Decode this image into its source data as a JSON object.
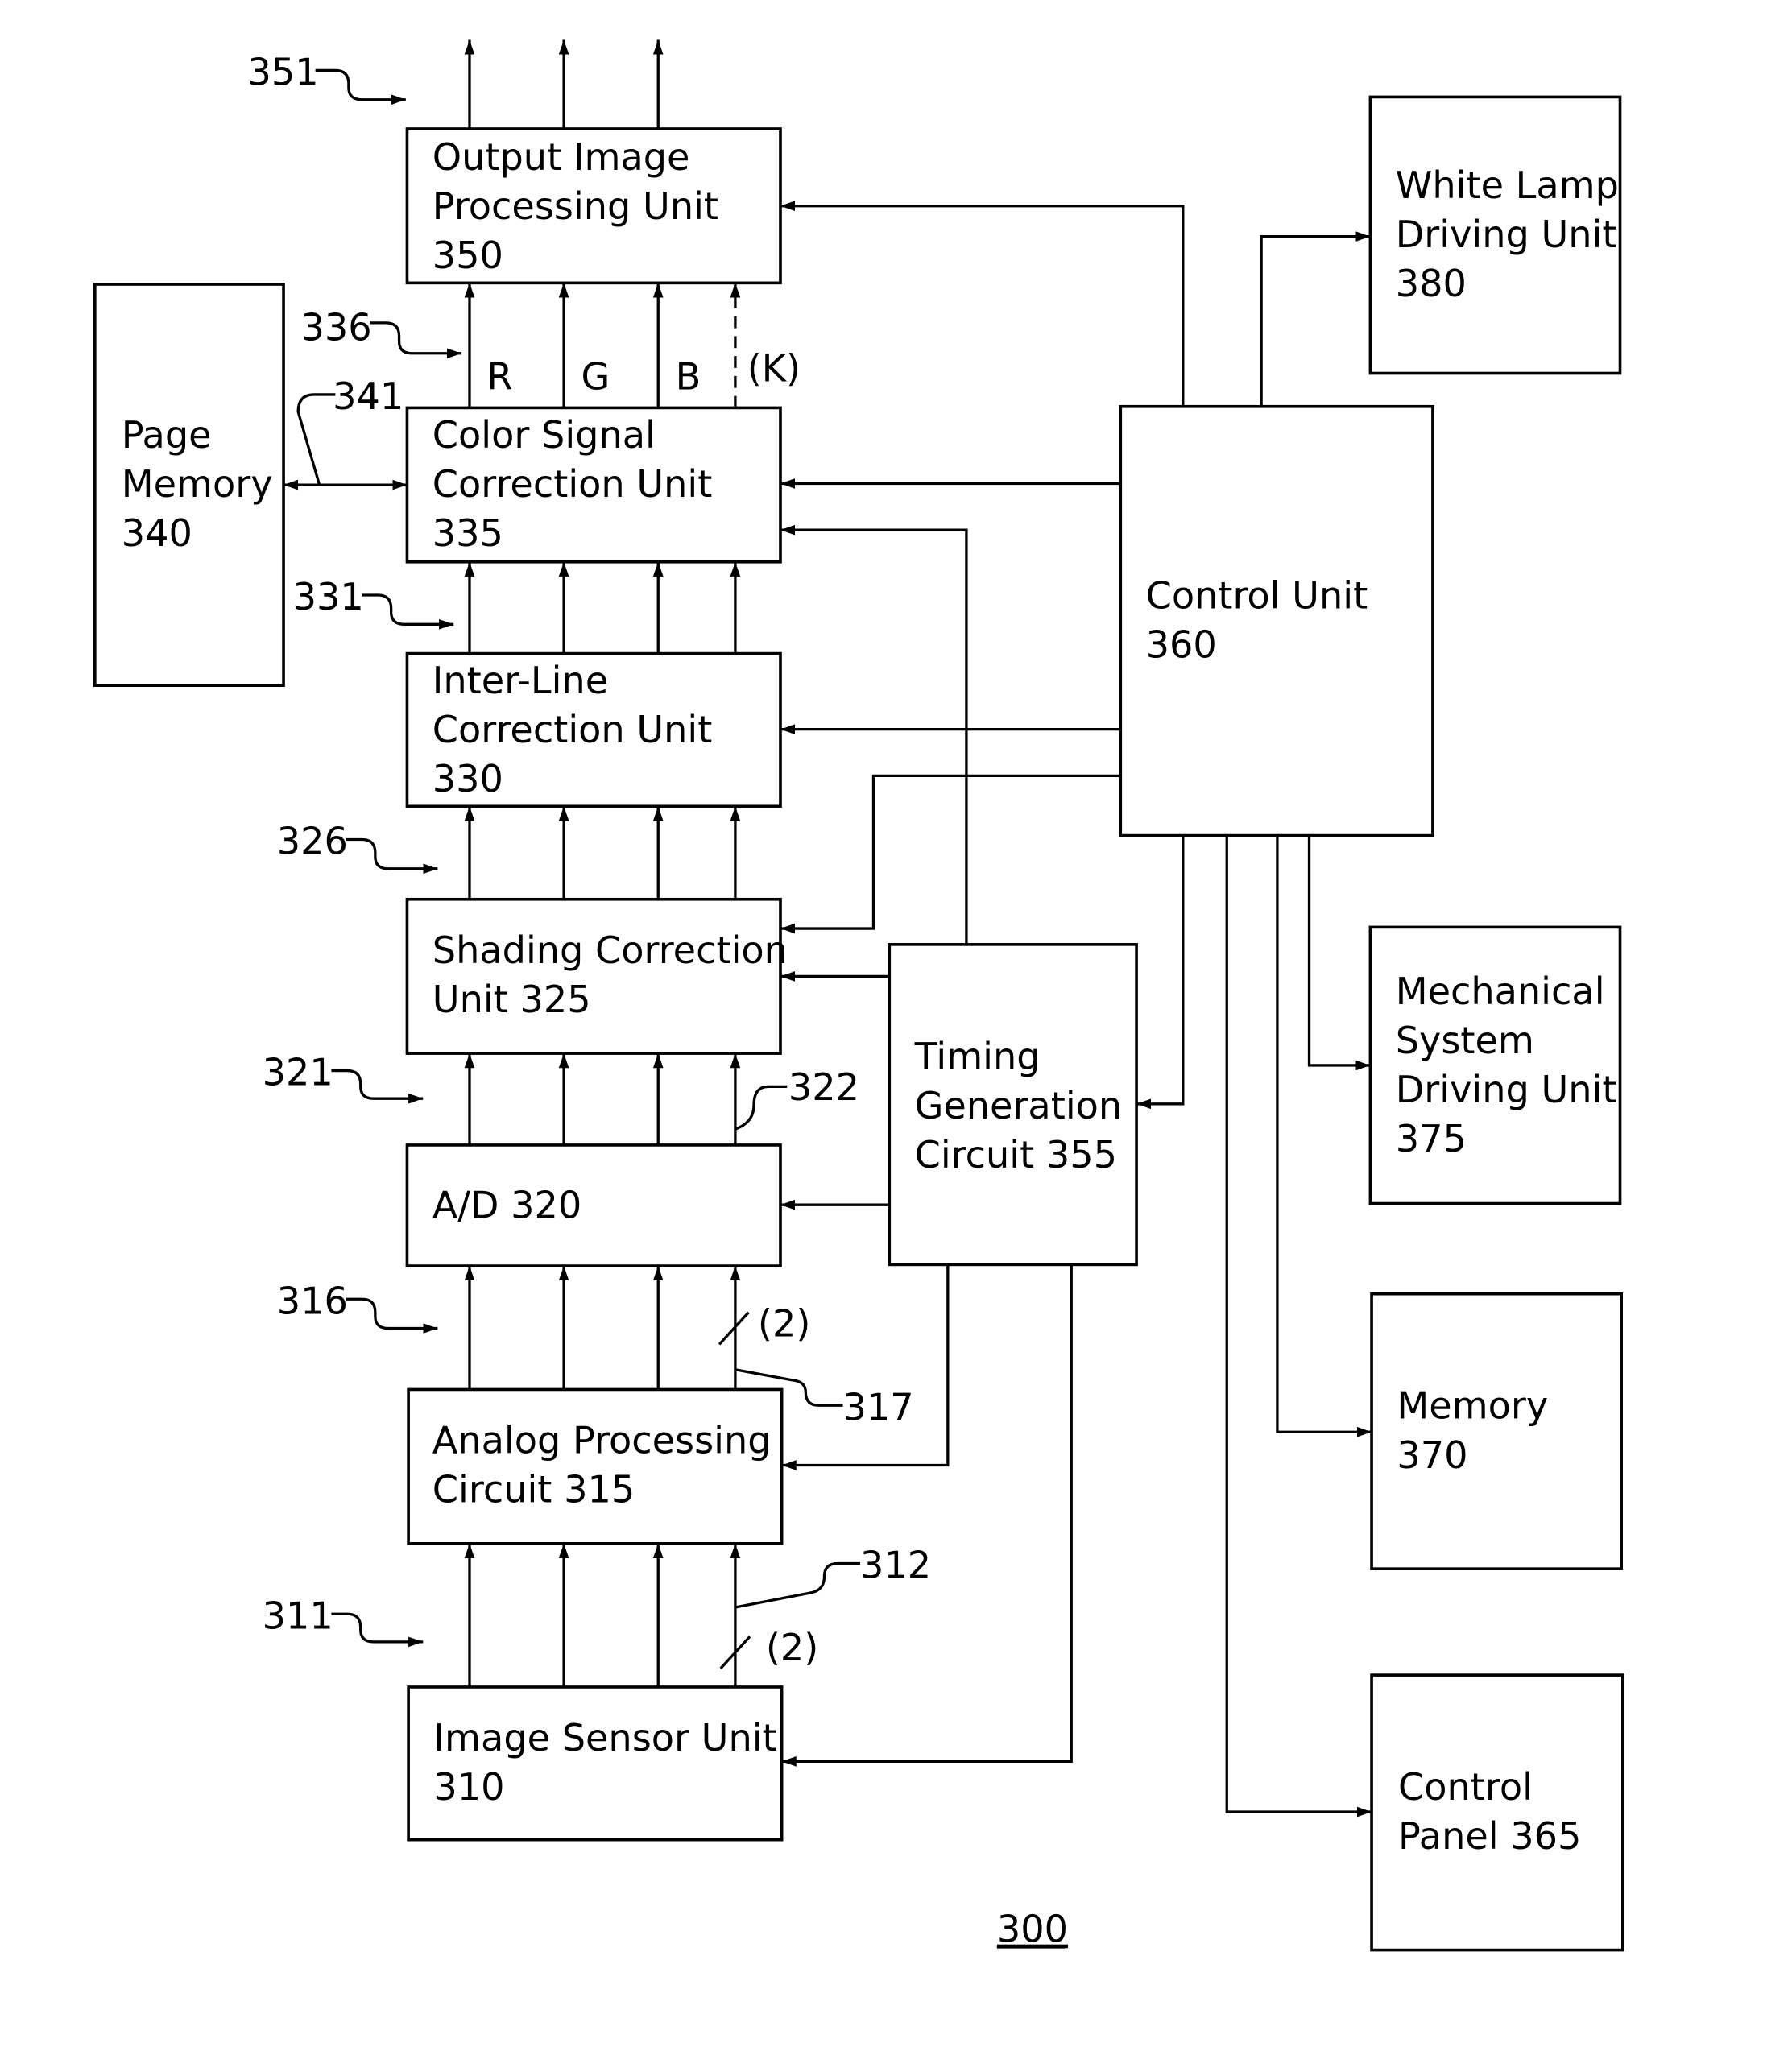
{
  "figure_number": "300",
  "blocks": {
    "output_image_processing": {
      "lines": [
        "Output Image",
        "Processing Unit",
        "350"
      ]
    },
    "color_signal_correction": {
      "lines": [
        "Color Signal",
        "Correction Unit",
        "335"
      ]
    },
    "inter_line_correction": {
      "lines": [
        "Inter-Line",
        "Correction Unit",
        "330"
      ]
    },
    "shading_correction": {
      "lines": [
        "Shading Correction",
        "Unit 325"
      ]
    },
    "ad_converter": {
      "lines": [
        "A/D 320"
      ]
    },
    "analog_processing": {
      "lines": [
        "Analog Processing",
        "Circuit 315"
      ]
    },
    "image_sensor": {
      "lines": [
        "Image Sensor Unit",
        "310"
      ]
    },
    "page_memory": {
      "lines": [
        "Page",
        "Memory",
        "340"
      ]
    },
    "timing_generation": {
      "lines": [
        "Timing",
        "Generation",
        "Circuit 355"
      ]
    },
    "control_unit": {
      "lines": [
        "Control Unit",
        "360"
      ]
    },
    "white_lamp_driving": {
      "lines": [
        "White Lamp",
        "Driving Unit",
        "380"
      ]
    },
    "mechanical_system_driving": {
      "lines": [
        "Mechanical",
        "System",
        "Driving Unit",
        "375"
      ]
    },
    "memory": {
      "lines": [
        "Memory",
        "370"
      ]
    },
    "control_panel": {
      "lines": [
        "Control",
        "Panel 365"
      ]
    }
  },
  "signal_labels": {
    "r": "R",
    "g": "G",
    "b": "B",
    "k": "(K)",
    "bus_width_upper": "(2)",
    "bus_width_lower": "(2)"
  },
  "reference_numerals": {
    "r351": "351",
    "r336": "336",
    "r341": "341",
    "r331": "331",
    "r326": "326",
    "r321": "321",
    "r322": "322",
    "r316": "316",
    "r317": "317",
    "r311": "311",
    "r312": "312"
  }
}
